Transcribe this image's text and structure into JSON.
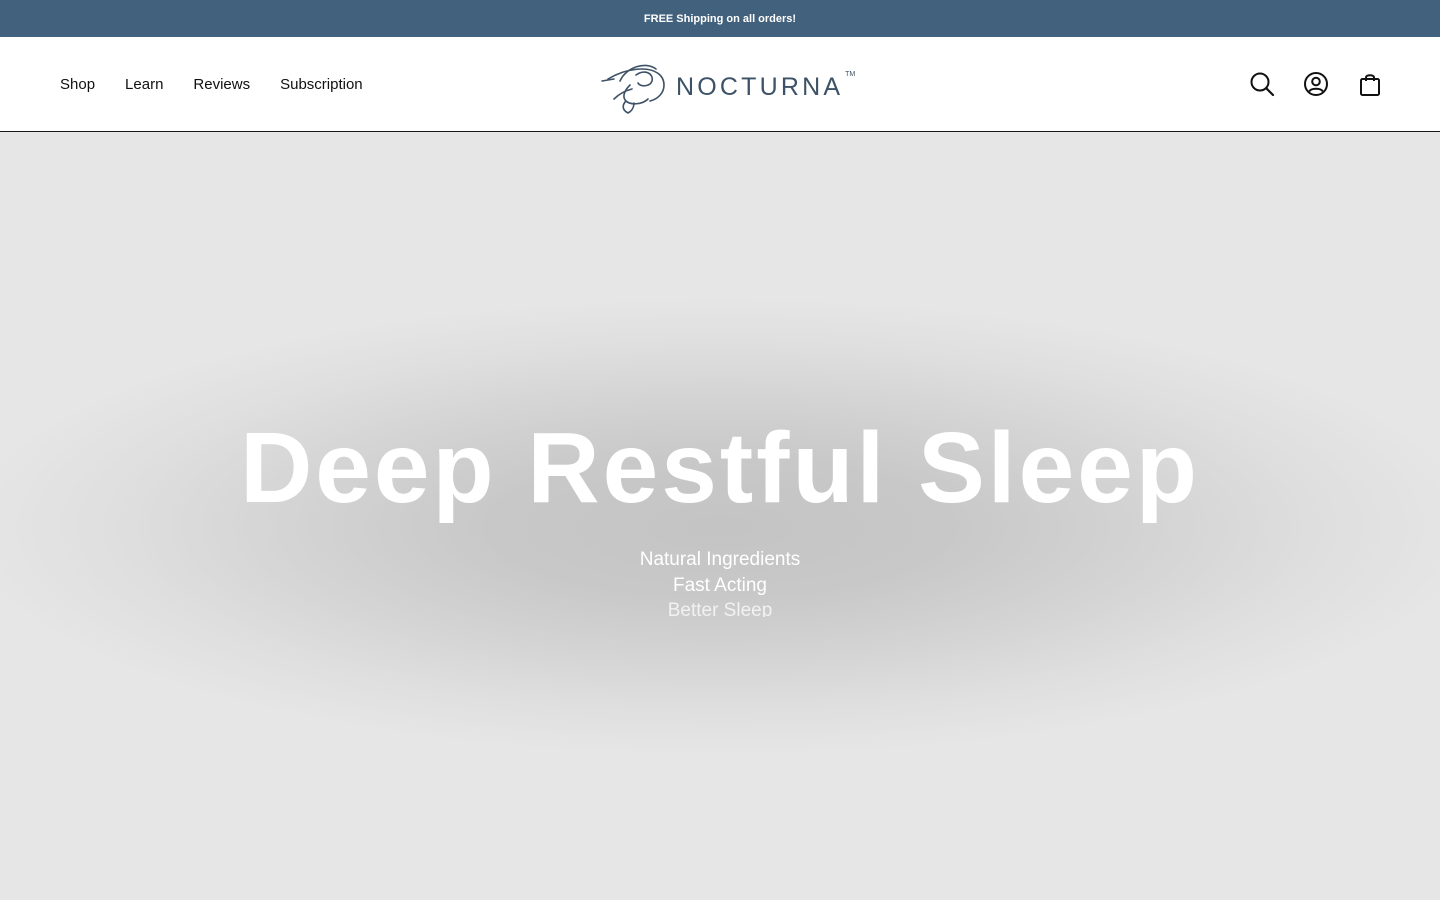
{
  "colors": {
    "announcement_bg": "#42617d",
    "header_bg": "#ffffff",
    "logo": "#3d5266",
    "hero_bg": "#e6e6e6",
    "hero_text": "#ffffff"
  },
  "announcement": {
    "text": "FREE Shipping on all orders!"
  },
  "nav": {
    "items": [
      {
        "label": "Shop"
      },
      {
        "label": "Learn"
      },
      {
        "label": "Reviews"
      },
      {
        "label": "Subscription"
      }
    ]
  },
  "logo": {
    "wordmark": "NOCTURNA",
    "trademark": "TM"
  },
  "header_icons": {
    "search": "search-icon",
    "account": "account-icon",
    "cart": "shopping-bag-icon"
  },
  "hero": {
    "title": "Deep Restful Sleep",
    "lines": [
      "Natural Ingredients",
      "Fast Acting",
      "Better Sleep"
    ]
  }
}
